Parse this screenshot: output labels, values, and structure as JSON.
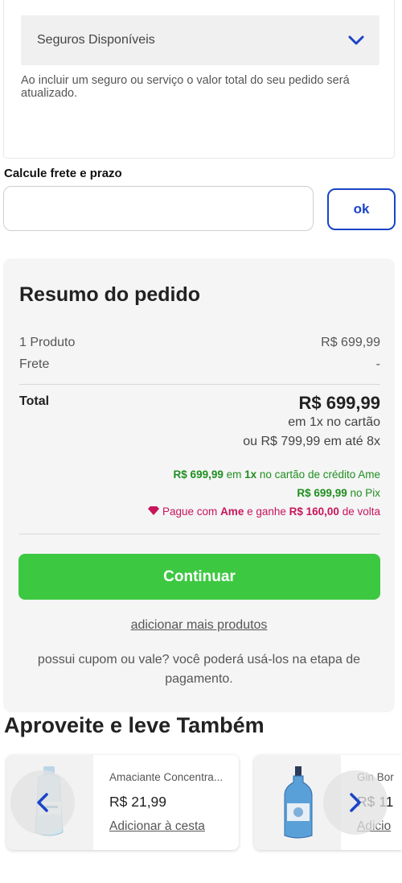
{
  "insurance": {
    "select_label": "Seguros Disponíveis",
    "note": "Ao incluir um seguro ou serviço o valor total do seu pedido será atualizado."
  },
  "freight": {
    "title": "Calcule frete e prazo",
    "input_value": "",
    "ok_label": "ok"
  },
  "summary": {
    "title": "Resumo do pedido",
    "products_label": "1 Produto",
    "products_value": "R$ 699,99",
    "freight_label": "Frete",
    "freight_value": "-",
    "total_label": "Total",
    "total_value": "R$ 699,99",
    "installment_card": "em 1x no cartão",
    "installment_alt": "ou R$ 799,99 em até 8x",
    "ame_credit": {
      "price": "R$ 699,99",
      "text1": " em ",
      "times": "1x",
      "text2": " no cartão de crédito Ame"
    },
    "pix": {
      "price": "R$ 699,99",
      "text": " no Pix"
    },
    "cashback": {
      "text1": "Pague com ",
      "brand": "Ame",
      "text2": " e ganhe ",
      "amount": "R$ 160,00",
      "text3": " de volta"
    },
    "continue_label": "Continuar",
    "more_products_label": "adicionar mais produtos",
    "coupon_note": "possui cupom ou vale? você poderá usá-los na etapa de pagamento."
  },
  "recommendations": {
    "title": "Aproveite e leve Também",
    "items": [
      {
        "name": "Amaciante Concentra...",
        "price": "R$ 21,99",
        "add_label": "Adicionar à cesta"
      },
      {
        "name": "Gin Bor",
        "price": "R$ 11",
        "add_label": "Adicio"
      }
    ]
  },
  "icons": {
    "dropdown": "chevron-down-icon",
    "heart": "heart-icon",
    "prev": "chevron-left-icon",
    "next": "chevron-right-icon"
  },
  "colors": {
    "accent_blue": "#1a44c8",
    "continue_green": "#3dc842",
    "ame_green": "#1f8f1f",
    "ame_pink": "#c8155a"
  }
}
